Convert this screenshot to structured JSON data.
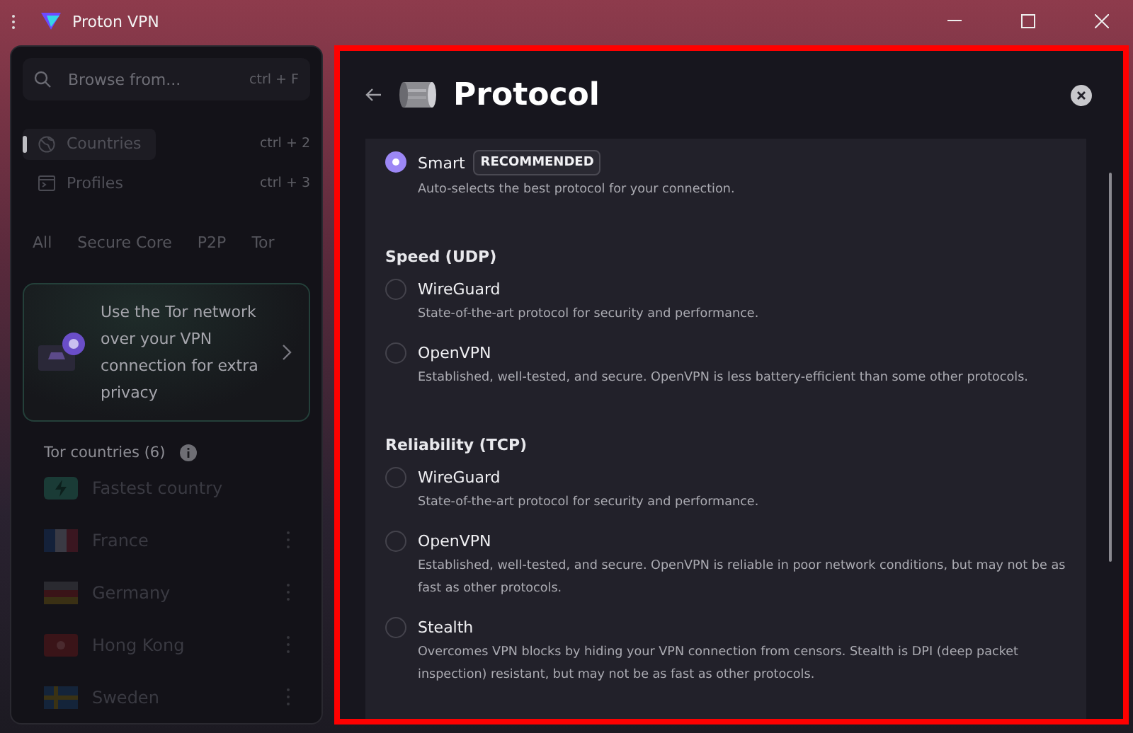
{
  "window": {
    "title": "Proton VPN"
  },
  "sidebar": {
    "search": {
      "placeholder": "Browse from...",
      "shortcut": "ctrl + F"
    },
    "nav": [
      {
        "label": "Countries",
        "shortcut": "ctrl + 2",
        "selected": true,
        "kind": "globe"
      },
      {
        "label": "Profiles",
        "shortcut": "ctrl + 3",
        "selected": false,
        "kind": "terminal"
      }
    ],
    "filters": [
      {
        "label": "All"
      },
      {
        "label": "Secure Core"
      },
      {
        "label": "P2P"
      },
      {
        "label": "Tor"
      }
    ],
    "promo": {
      "text": "Use the Tor network over your VPN connection for extra privacy"
    },
    "list_title": "Tor countries (6)",
    "countries": [
      {
        "name": "Fastest country",
        "kind": "fastest"
      },
      {
        "name": "France",
        "kind": "france"
      },
      {
        "name": "Germany",
        "kind": "germany"
      },
      {
        "name": "Hong Kong",
        "kind": "hongkong"
      },
      {
        "name": "Sweden",
        "kind": "sweden"
      }
    ]
  },
  "panel": {
    "title": "Protocol",
    "groups": [
      {
        "options": [
          {
            "name": "Smart",
            "badge": "RECOMMENDED",
            "description": "Auto-selects the best protocol for your connection.",
            "selected": true
          }
        ]
      },
      {
        "heading": "Speed (UDP)",
        "options": [
          {
            "name": "WireGuard",
            "description": "State-of-the-art protocol for security and performance.",
            "selected": false
          },
          {
            "name": "OpenVPN",
            "description": "Established, well-tested, and secure. OpenVPN is less battery-efficient than some other protocols.",
            "selected": false
          }
        ]
      },
      {
        "heading": "Reliability (TCP)",
        "options": [
          {
            "name": "WireGuard",
            "description": "State-of-the-art protocol for security and performance.",
            "selected": false
          },
          {
            "name": "OpenVPN",
            "description": "Established, well-tested, and secure. OpenVPN is reliable in poor network conditions, but may not be as fast as other protocols.",
            "selected": false
          },
          {
            "name": "Stealth",
            "description": "Overcomes VPN blocks by hiding your VPN connection from censors. Stealth is DPI (deep packet inspection) resistant, but may not be as fast as other protocols.",
            "selected": false
          }
        ]
      }
    ]
  }
}
